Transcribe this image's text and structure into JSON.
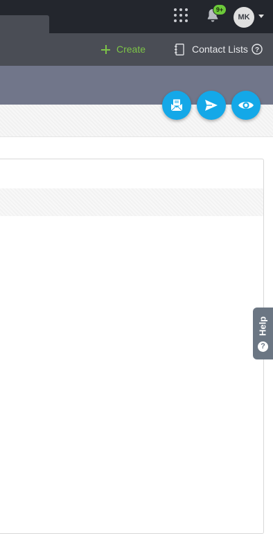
{
  "topbar": {
    "notification_count": "9+",
    "avatar_initials": "MK"
  },
  "secondary_nav": {
    "create_label": "Create",
    "contact_lists_label": "Contact Lists",
    "help_glyph": "?"
  },
  "help_tab": {
    "label": "Help",
    "glyph": "?"
  },
  "icons": [
    "apps-grid-icon",
    "bell-icon",
    "chevron-down-icon",
    "plus-icon",
    "address-book-icon",
    "help-circle-icon",
    "email-preview-icon",
    "send-icon",
    "eye-icon"
  ],
  "colors": {
    "topbar": "#23262d",
    "secondary_bar": "#4a4d55",
    "band": "#71768a",
    "accent_green": "#7dc448",
    "fab_blue": "#14a8e8",
    "badge_green": "#6cc93a",
    "help_tab": "#6b7683"
  }
}
